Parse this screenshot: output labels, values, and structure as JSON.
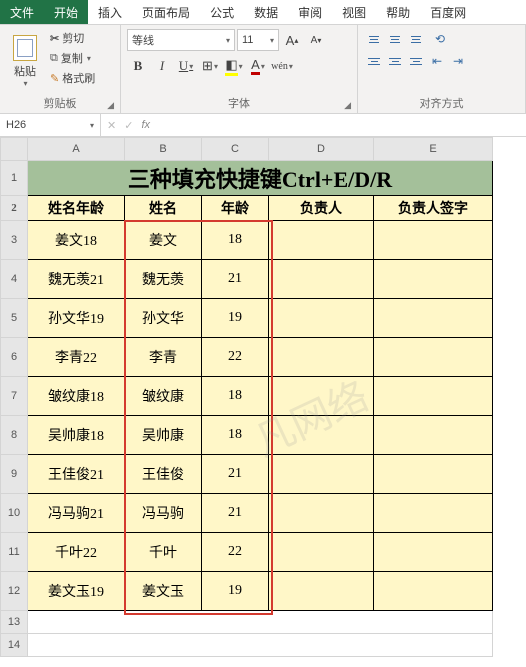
{
  "menu": {
    "file": "文件",
    "tabs": [
      "开始",
      "插入",
      "页面布局",
      "公式",
      "数据",
      "审阅",
      "视图",
      "帮助",
      "百度网"
    ],
    "active": 0
  },
  "ribbon": {
    "clipboard": {
      "label": "剪贴板",
      "paste": "粘贴",
      "cut": "剪切",
      "copy": "复制",
      "brush": "格式刷"
    },
    "font": {
      "label": "字体",
      "name": "等线",
      "size": "11",
      "grow": "A",
      "shrink": "A",
      "B": "B",
      "I": "I",
      "U": "U",
      "wen": "wén"
    },
    "align": {
      "label": "对齐方式"
    }
  },
  "namebox": {
    "ref": "H26",
    "fx": "fx"
  },
  "columns": [
    "A",
    "B",
    "C",
    "D",
    "E"
  ],
  "sheet": {
    "title": "三种填充快捷键Ctrl+E/D/R",
    "headers": [
      "姓名年龄",
      "姓名",
      "年龄",
      "负责人",
      "负责人签字"
    ],
    "rows": [
      {
        "a": "姜文18",
        "b": "姜文",
        "c": "18"
      },
      {
        "a": "魏无羡21",
        "b": "魏无羡",
        "c": "21"
      },
      {
        "a": "孙文华19",
        "b": "孙文华",
        "c": "19"
      },
      {
        "a": "李青22",
        "b": "李青",
        "c": "22"
      },
      {
        "a": "皱纹康18",
        "b": "皱纹康",
        "c": "18"
      },
      {
        "a": "吴帅康18",
        "b": "吴帅康",
        "c": "18"
      },
      {
        "a": "王佳俊21",
        "b": "王佳俊",
        "c": "21"
      },
      {
        "a": "冯马驹21",
        "b": "冯马驹",
        "c": "21"
      },
      {
        "a": "千叶22",
        "b": "千叶",
        "c": "22"
      },
      {
        "a": "姜文玉19",
        "b": "姜文玉",
        "c": "19"
      }
    ]
  },
  "watermark": "凡网络"
}
